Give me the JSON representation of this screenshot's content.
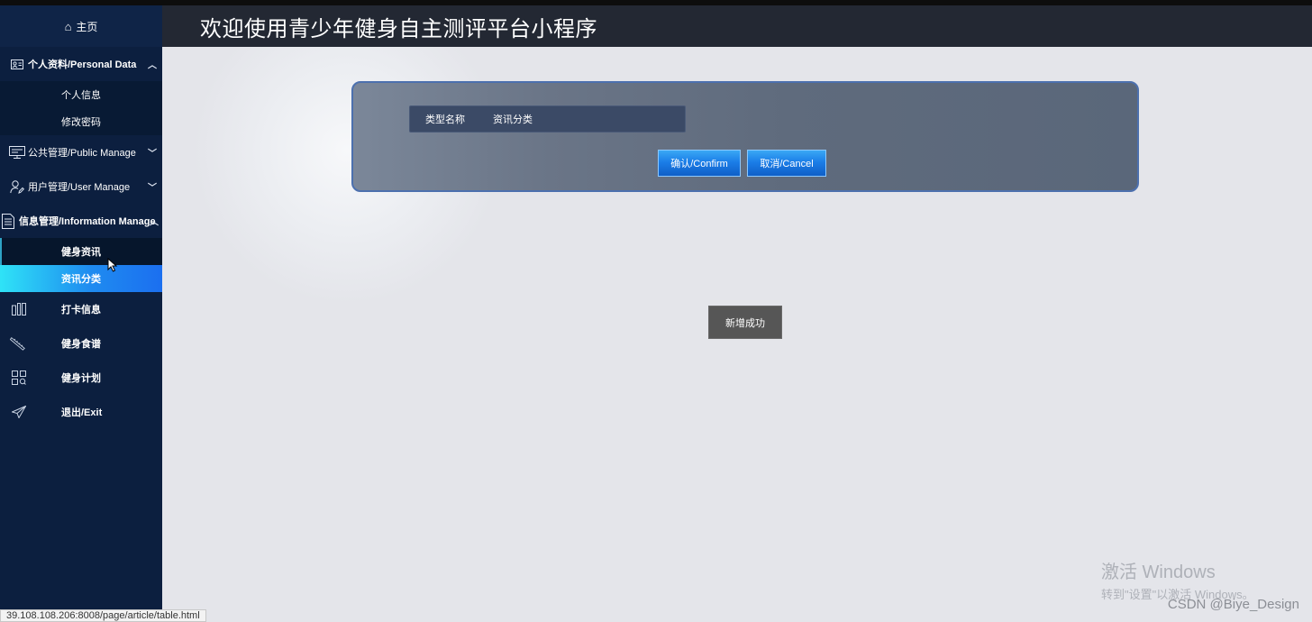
{
  "sidebar": {
    "home": "主页",
    "groups": {
      "personal": "个人资料/Personal Data",
      "public": "公共管理/Public Manage",
      "user": "用户管理/User Manage",
      "info": "信息管理/Information Manage"
    },
    "personal_items": [
      "个人信息",
      "修改密码"
    ],
    "info_items": [
      "健身资讯",
      "资讯分类"
    ],
    "items": [
      "打卡信息",
      "健身食谱",
      "健身计划",
      "退出/Exit"
    ]
  },
  "header": {
    "title": "欢迎使用青少年健身自主测评平台小程序"
  },
  "form": {
    "field_label": "类型名称",
    "field_value": "资讯分类",
    "confirm_label": "确认/Confirm",
    "cancel_label": "取消/Cancel"
  },
  "toast": "新增成功",
  "watermark": {
    "line1": "激活 Windows",
    "line2": "转到\"设置\"以激活 Windows。"
  },
  "credit": "CSDN @Biye_Design",
  "status_url": "39.108.108.206:8008/page/article/table.html",
  "colors": {
    "sidebar_bg": "#0c1f3f",
    "active_gradient_start": "#2fe3f7",
    "active_gradient_end": "#1b6ff0",
    "header_bg": "#232833"
  }
}
